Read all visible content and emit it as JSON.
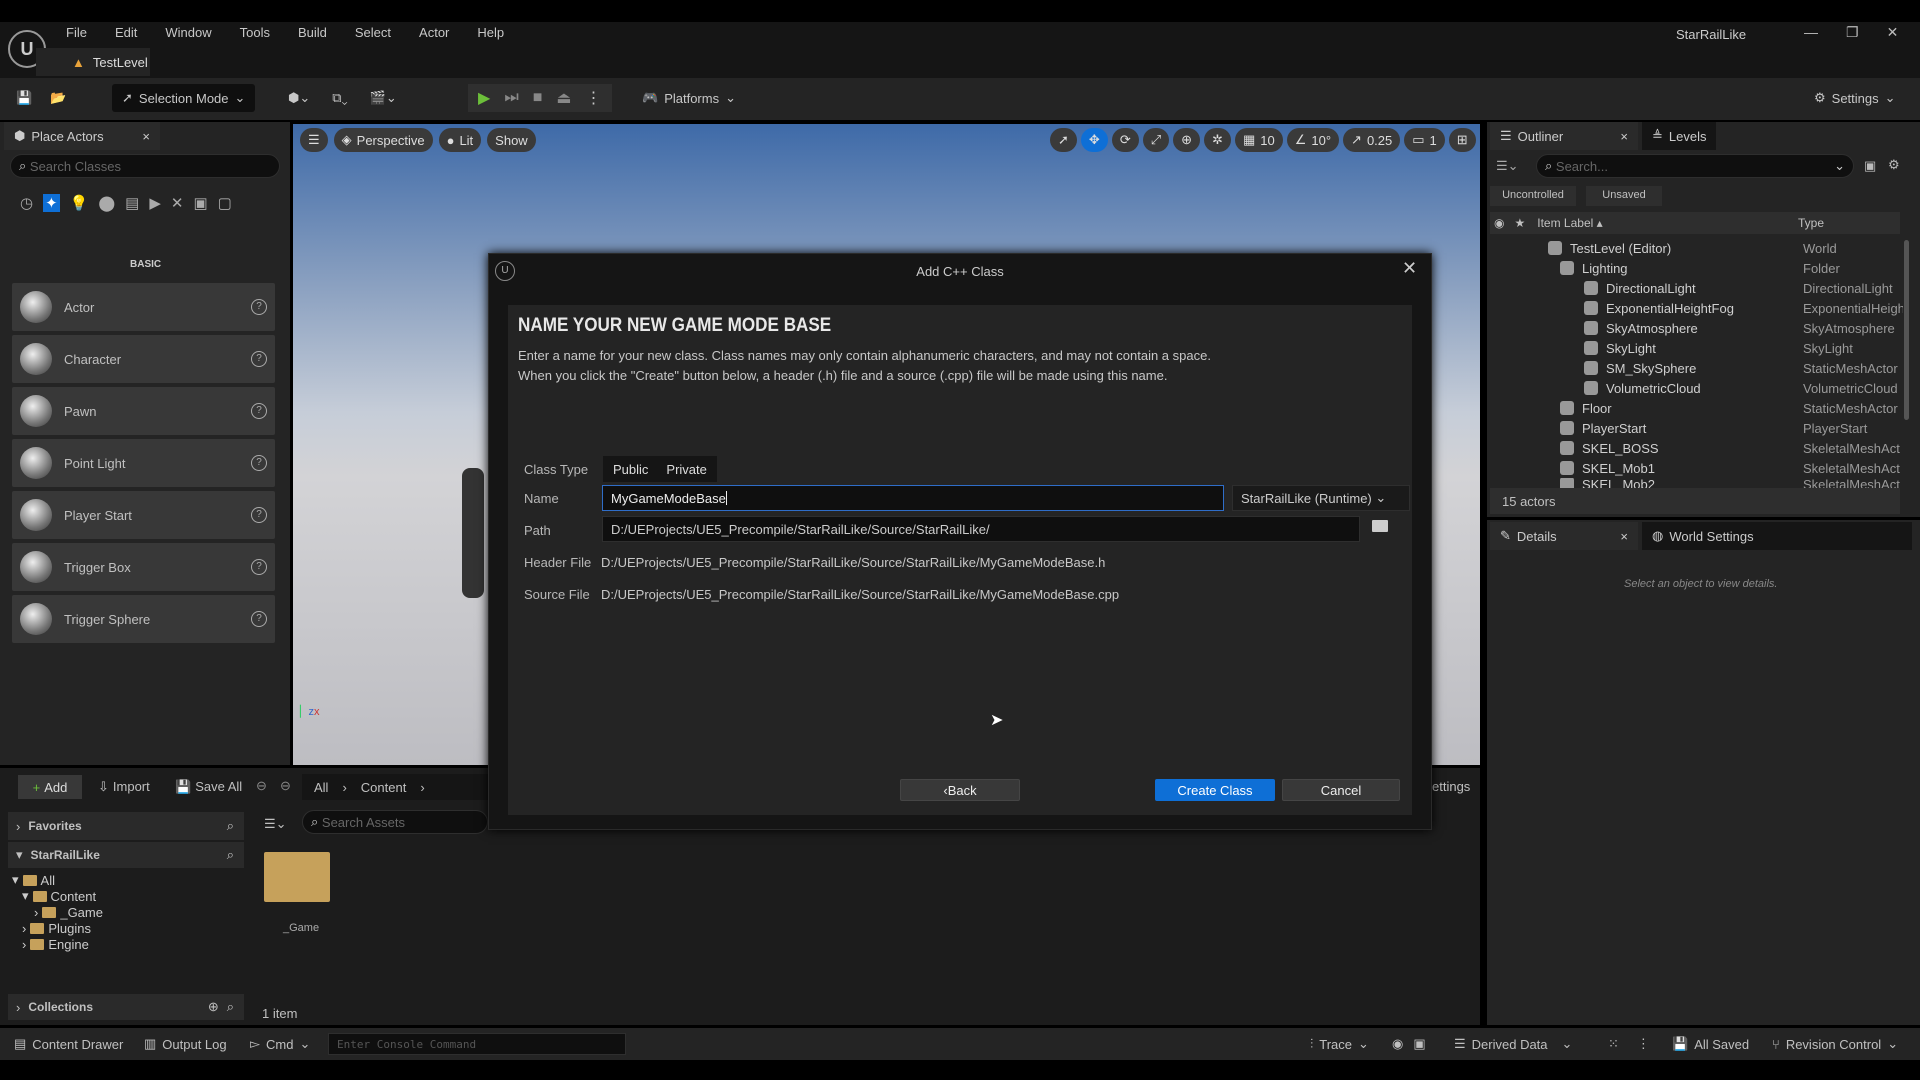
{
  "window": {
    "project": "StarRailLike",
    "level_tab": "TestLevel"
  },
  "menu": [
    "File",
    "Edit",
    "Window",
    "Tools",
    "Build",
    "Select",
    "Actor",
    "Help"
  ],
  "toolbar": {
    "selection_mode": "Selection Mode",
    "platforms": "Platforms",
    "settings": "Settings"
  },
  "place_actors": {
    "tab": "Place Actors",
    "search_placeholder": "Search Classes",
    "category": "BASIC",
    "items": [
      "Actor",
      "Character",
      "Pawn",
      "Point Light",
      "Player Start",
      "Trigger Box",
      "Trigger Sphere"
    ]
  },
  "viewport": {
    "perspective": "Perspective",
    "lit": "Lit",
    "show": "Show",
    "grid": "10",
    "angle": "10°",
    "scale": "0.25",
    "camera": "1"
  },
  "outliner": {
    "tab": "Outliner",
    "levels_tab": "Levels",
    "search_placeholder": "Search...",
    "filters": [
      "Uncontrolled",
      "Unsaved"
    ],
    "col_label": "Item Label",
    "col_type": "Type",
    "rows": [
      {
        "label": "TestLevel (Editor)",
        "type": "World",
        "indent": 0
      },
      {
        "label": "Lighting",
        "type": "Folder",
        "indent": 1
      },
      {
        "label": "DirectionalLight",
        "type": "DirectionalLight",
        "indent": 2
      },
      {
        "label": "ExponentialHeightFog",
        "type": "ExponentialHeigh",
        "indent": 2
      },
      {
        "label": "SkyAtmosphere",
        "type": "SkyAtmosphere",
        "indent": 2
      },
      {
        "label": "SkyLight",
        "type": "SkyLight",
        "indent": 2
      },
      {
        "label": "SM_SkySphere",
        "type": "StaticMeshActor",
        "indent": 2
      },
      {
        "label": "VolumetricCloud",
        "type": "VolumetricCloud",
        "indent": 2
      },
      {
        "label": "Floor",
        "type": "StaticMeshActor",
        "indent": 1
      },
      {
        "label": "PlayerStart",
        "type": "PlayerStart",
        "indent": 1
      },
      {
        "label": "SKEL_BOSS",
        "type": "SkeletalMeshAct",
        "indent": 1
      },
      {
        "label": "SKEL_Mob1",
        "type": "SkeletalMeshAct",
        "indent": 1
      },
      {
        "label": "SKEL_Mob2",
        "type": "SkeletalMeshAct",
        "indent": 1
      }
    ],
    "count": "15 actors"
  },
  "details": {
    "tab": "Details",
    "world_settings_tab": "World Settings",
    "empty": "Select an object to view details."
  },
  "dialog": {
    "title": "Add C++ Class",
    "heading": "NAME YOUR NEW GAME MODE BASE",
    "desc1": "Enter a name for your new class. Class names may only contain alphanumeric characters, and may not contain a space.",
    "desc2": "When you click the \"Create\" button below, a header (.h) file and a source (.cpp) file will be made using this name.",
    "class_type_label": "Class Type",
    "public": "Public",
    "private": "Private",
    "name_label": "Name",
    "name_value": "MyGameModeBase",
    "module": "StarRailLike (Runtime)",
    "path_label": "Path",
    "path_value": "D:/UEProjects/UE5_Precompile/StarRailLike/Source/StarRailLike/",
    "header_label": "Header File",
    "header_value": "D:/UEProjects/UE5_Precompile/StarRailLike/Source/StarRailLike/MyGameModeBase.h",
    "source_label": "Source File",
    "source_value": "D:/UEProjects/UE5_Precompile/StarRailLike/Source/StarRailLike/MyGameModeBase.cpp",
    "back": "‹Back",
    "create": "Create Class",
    "cancel": "Cancel"
  },
  "content_browser": {
    "add": "Add",
    "import": "Import",
    "save_all": "Save All",
    "breadcrumb": [
      "All",
      "Content"
    ],
    "settings_partial": "ettings",
    "favorites": "Favorites",
    "project": "StarRailLike",
    "tree": [
      "All",
      "Content",
      "_Game",
      "Plugins",
      "Engine"
    ],
    "search_placeholder": "Search Assets",
    "asset": "_Game",
    "count": "1 item",
    "collections": "Collections"
  },
  "status_bar": {
    "content_drawer": "Content Drawer",
    "output_log": "Output Log",
    "cmd": "Cmd",
    "console_placeholder": "Enter Console Command",
    "trace": "Trace",
    "derived_data": "Derived Data",
    "all_saved": "All Saved",
    "revision_control": "Revision Control"
  },
  "colors": {
    "accent": "#0e6fd6",
    "play": "#6cbf3a",
    "folder": "#c6a15b"
  }
}
